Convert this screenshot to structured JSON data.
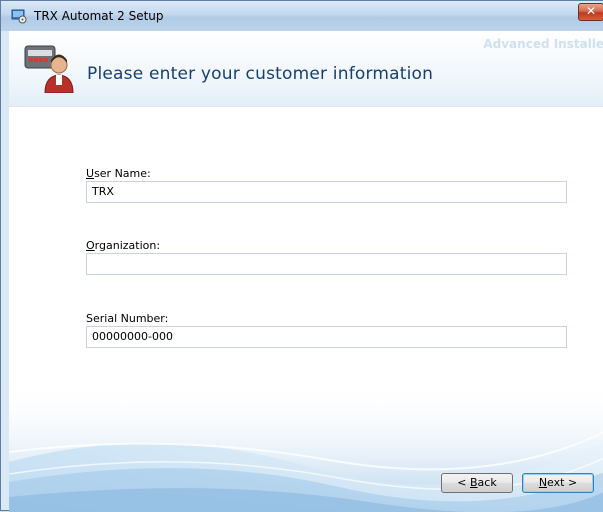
{
  "window": {
    "title": "TRX Automat 2 Setup",
    "close_label": "✕"
  },
  "header": {
    "title": "Please enter your customer information",
    "brand": "Advanced Installer"
  },
  "form": {
    "user_name": {
      "label_accel": "U",
      "label_rest": "ser Name:",
      "value": "TRX"
    },
    "organization": {
      "label_accel": "O",
      "label_rest": "rganization:",
      "value": ""
    },
    "serial_number": {
      "label": "Serial Number:",
      "value": "00000000-000"
    }
  },
  "buttons": {
    "back": {
      "prefix": "< ",
      "accel": "B",
      "rest": "ack"
    },
    "next": {
      "accel": "N",
      "rest": "ext >"
    }
  },
  "colors": {
    "accent": "#16406e",
    "titlebar": "#c2d7ee",
    "close": "#c0391d"
  }
}
